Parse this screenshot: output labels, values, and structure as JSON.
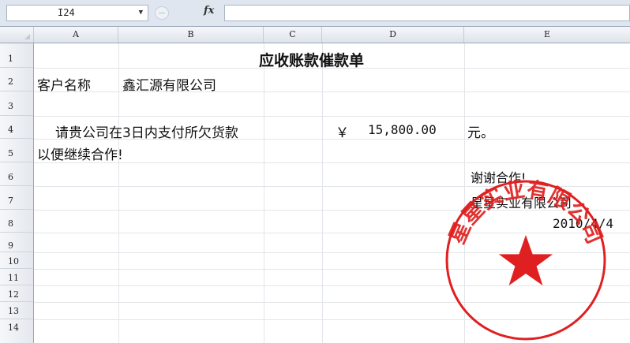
{
  "formula_bar": {
    "name_box": "I24",
    "fx_label": "fx",
    "formula": ""
  },
  "columns": [
    "A",
    "B",
    "C",
    "D",
    "E"
  ],
  "rows": [
    "1",
    "2",
    "3",
    "4",
    "5",
    "6",
    "7",
    "8",
    "9",
    "10",
    "11",
    "12",
    "13",
    "14"
  ],
  "sheet": {
    "title": "应收账款催款单",
    "customer_label": "客户名称",
    "customer_name": "鑫汇源有限公司",
    "request_text": "请贵公司在3日内支付所欠货款",
    "currency": "￥",
    "amount": "15,800.00",
    "unit": "元。",
    "cooperation": "以便继续合作!",
    "thanks": "谢谢合作!",
    "company": "星星实业有限公司",
    "date": "2010/4/4"
  },
  "stamp": {
    "text": "星星实业有限公司",
    "color": "#e02020",
    "symbol": "star"
  }
}
